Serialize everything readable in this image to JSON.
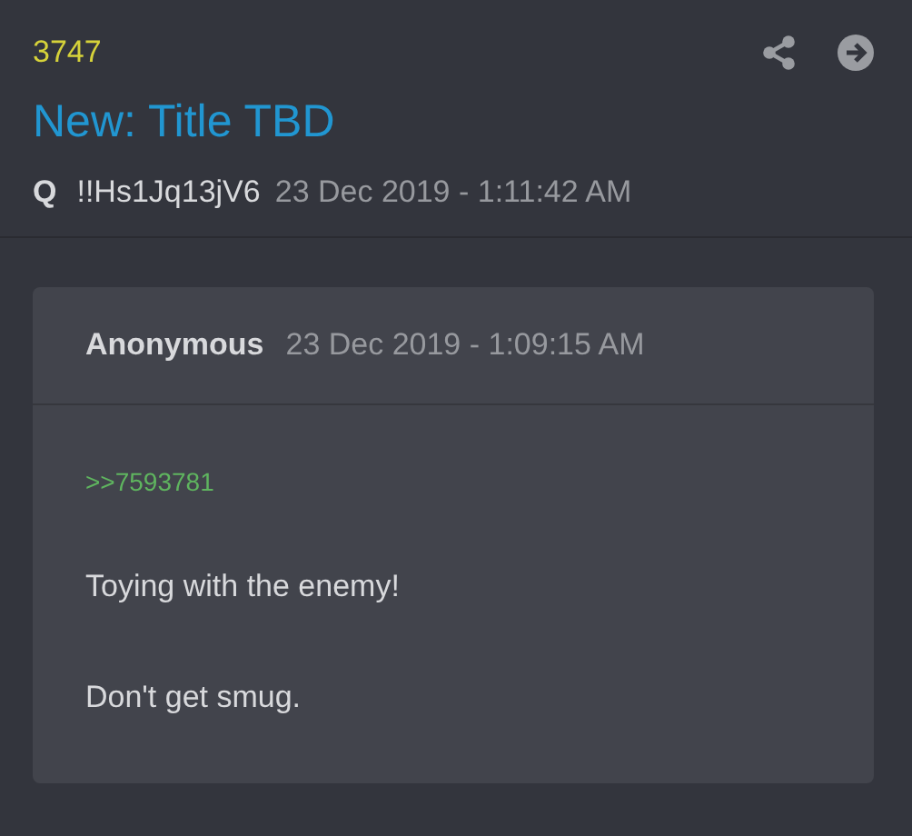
{
  "post": {
    "number": "3747",
    "title": "New: Title TBD",
    "author": "Q",
    "tripcode": "!!Hs1Jq13jV6",
    "time": "23 Dec 2019 - 1:11:42 AM"
  },
  "quoted": {
    "author": "Anonymous",
    "time": "23 Dec 2019 - 1:09:15 AM",
    "reference": ">>7593781",
    "paragraphs": [
      "Toying with the enemy!",
      "Don't get smug."
    ]
  }
}
